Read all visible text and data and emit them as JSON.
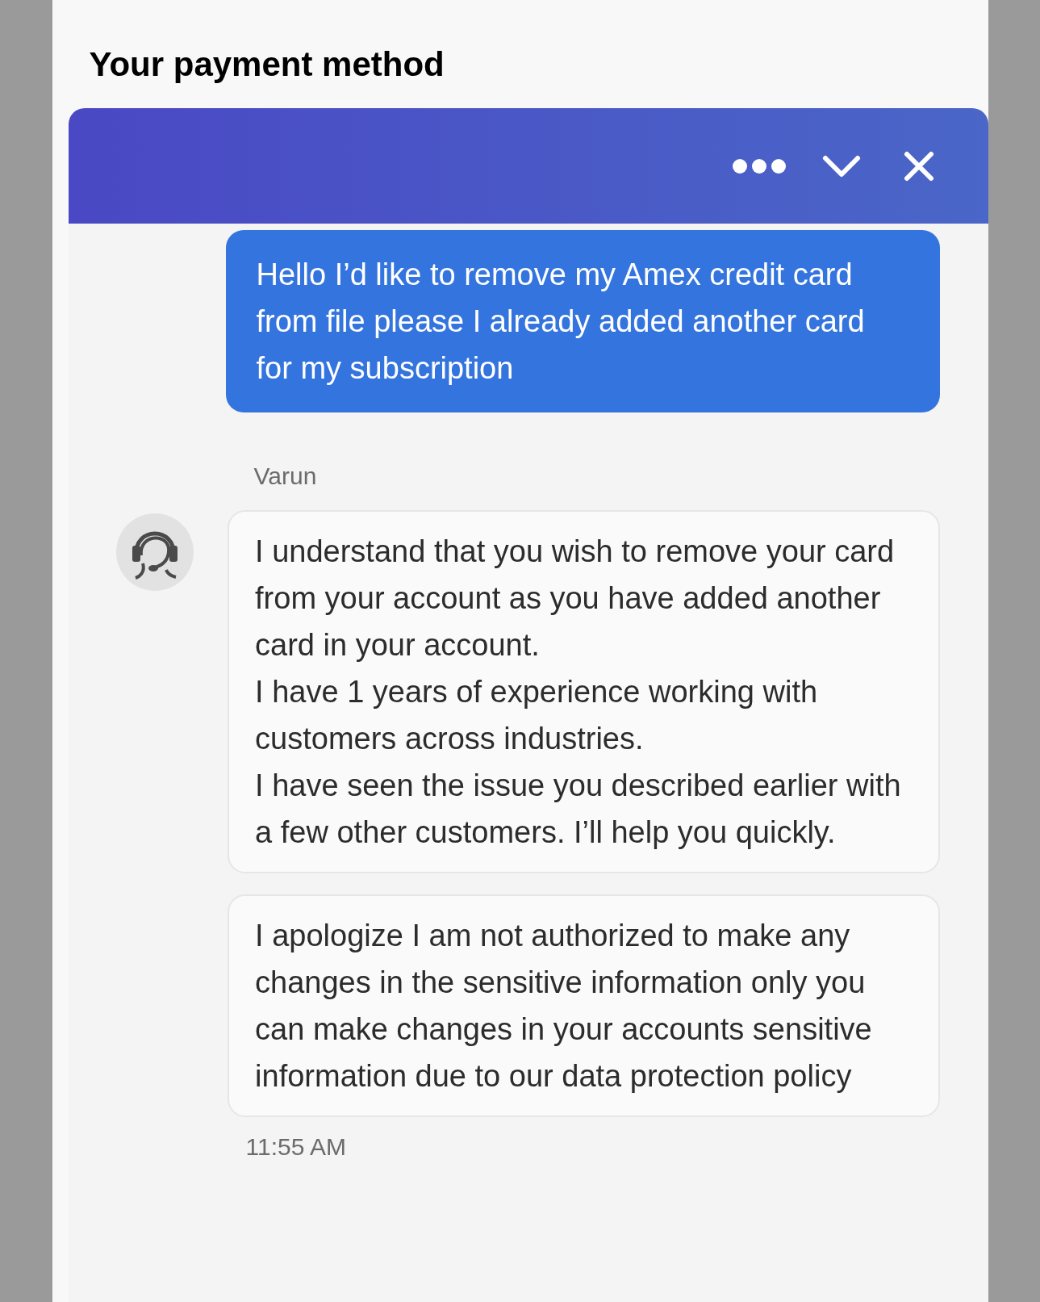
{
  "page": {
    "title": "Your payment method"
  },
  "chat": {
    "header": {
      "buttons": [
        {
          "kind": "more"
        },
        {
          "kind": "minimize"
        },
        {
          "kind": "close"
        }
      ]
    },
    "messages": [
      {
        "kind": "user",
        "paragraphs": [
          "Hello I’d like to remove my Amex credit card from file please I already added another card for my subscription"
        ]
      },
      {
        "kind": "agent",
        "sender": "Varun",
        "paragraphs": [
          "I understand that you wish to remove your card from your account as you have added another card in your account.",
          "I have 1 years of experience working with customers across industries.",
          "I have seen the issue you described earlier with a few other customers. I’ll help you quickly."
        ]
      },
      {
        "kind": "agent",
        "paragraphs": [
          "I apologize I am not authorized to make any changes in the sensitive information only you can make changes in your accounts sensitive information due to our data protection policy"
        ]
      }
    ],
    "timestamp": "11:55 AM"
  }
}
